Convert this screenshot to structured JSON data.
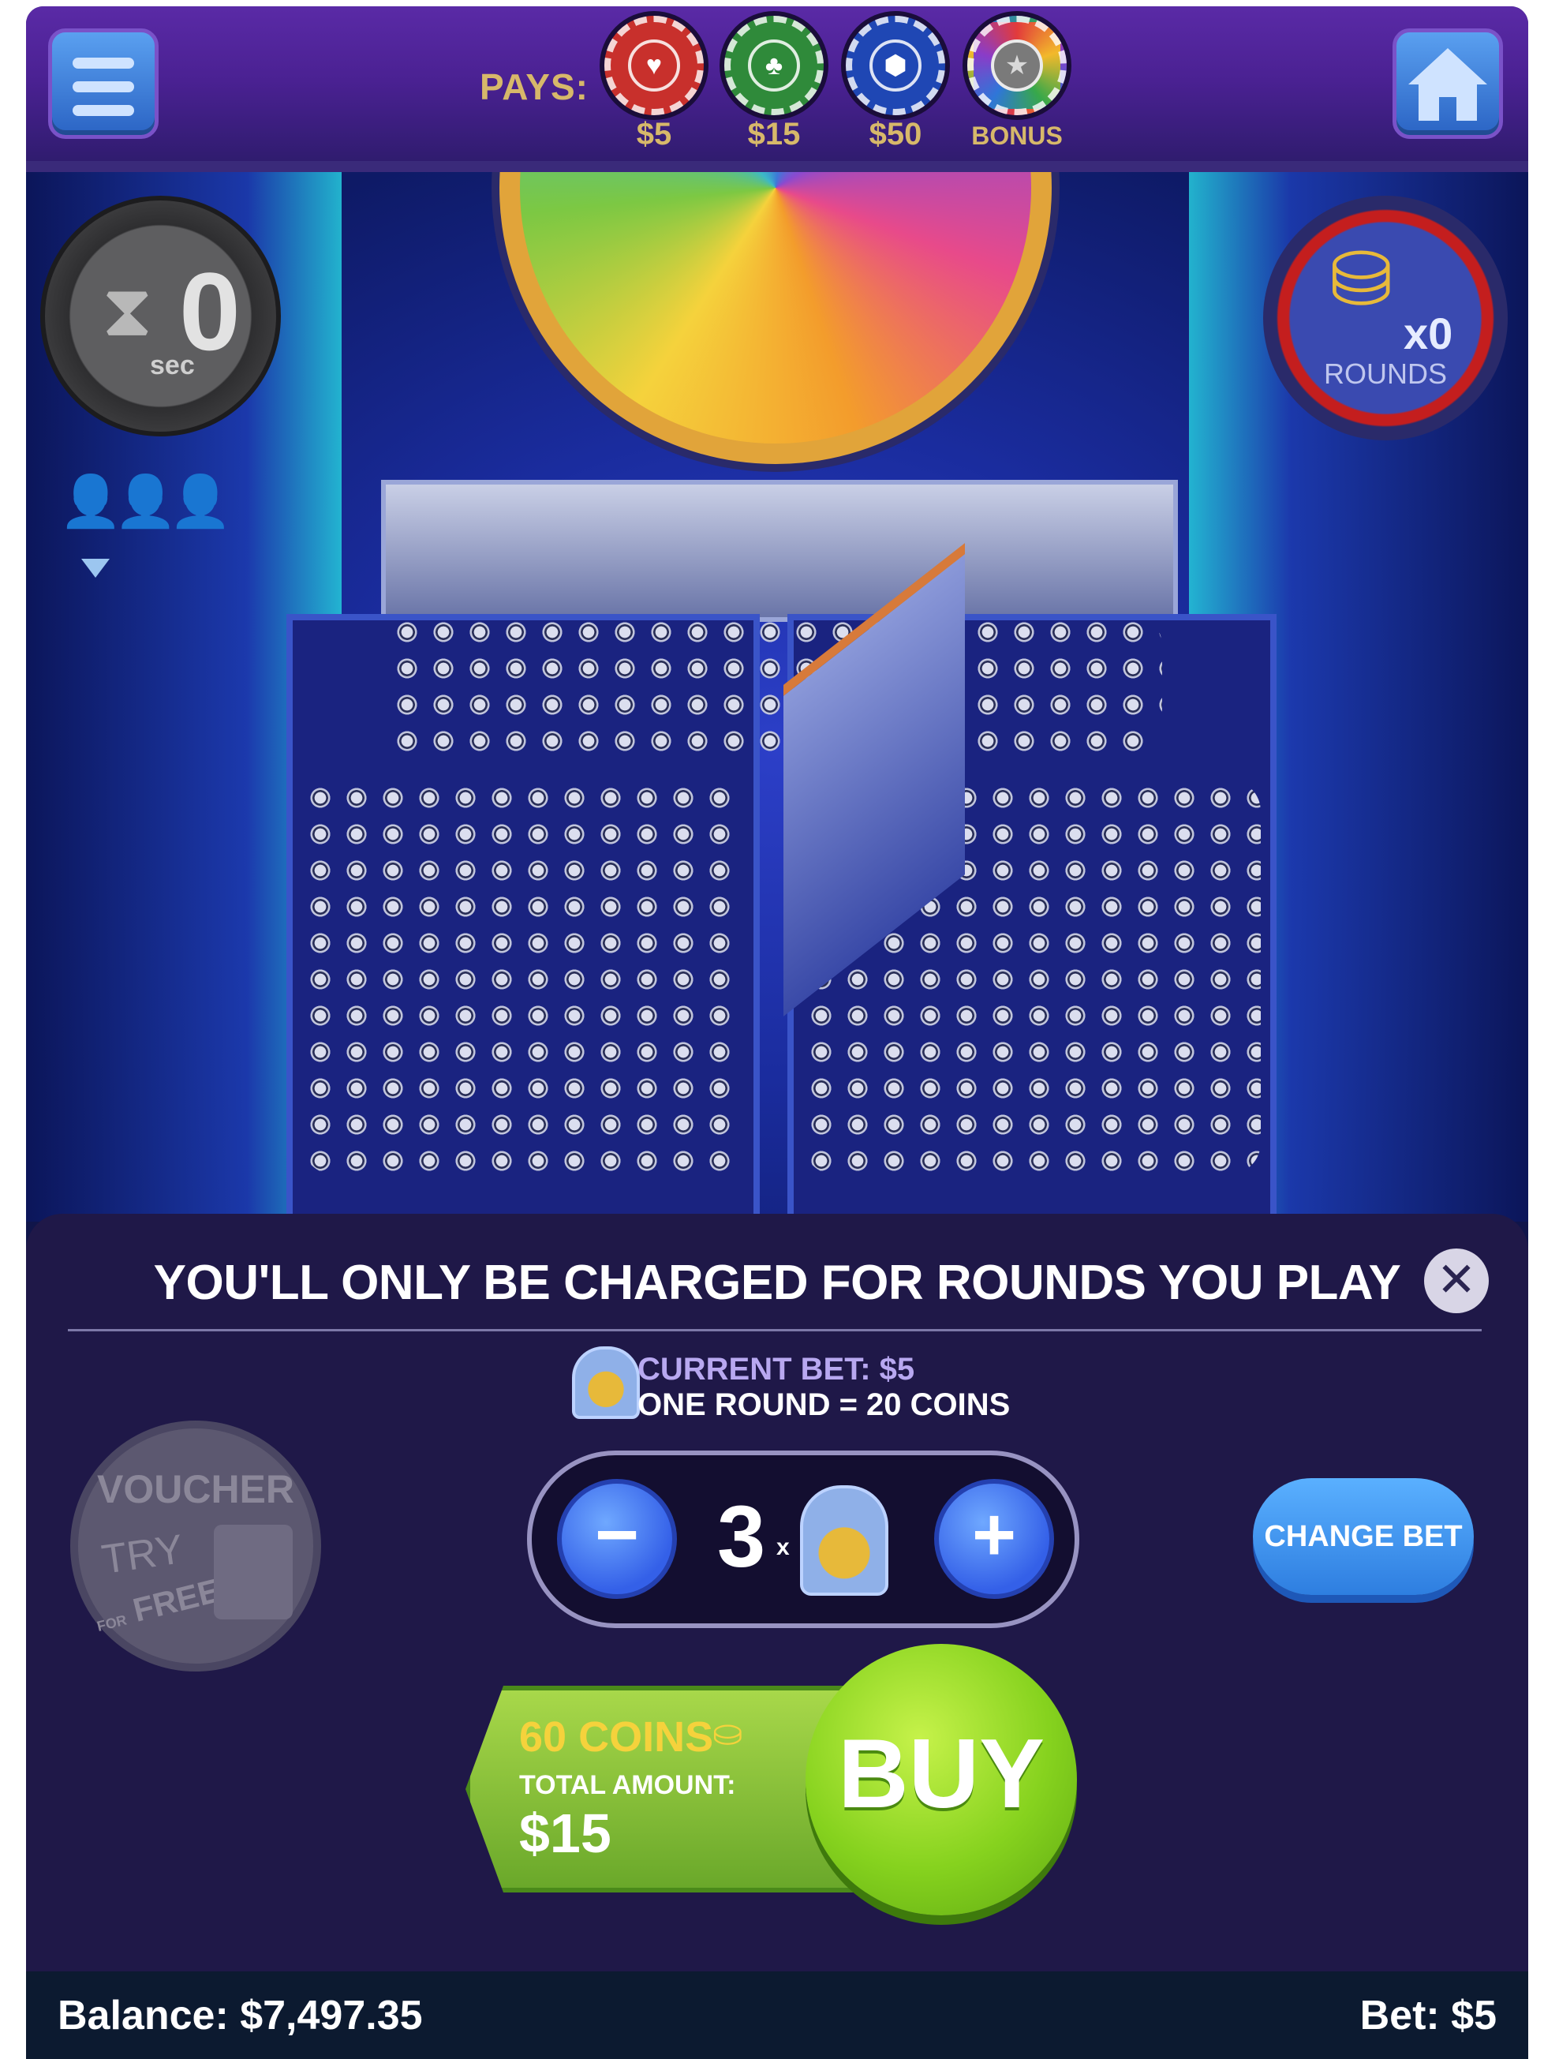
{
  "topbar": {
    "pays_label": "PAYS:",
    "chips": [
      {
        "value": "$5",
        "color": "#c8302c",
        "icon": "heart-icon"
      },
      {
        "value": "$15",
        "color": "#2f8a3a",
        "icon": "club-icon"
      },
      {
        "value": "$50",
        "color": "#1f47b4",
        "icon": "hexagon-icon"
      },
      {
        "value": "BONUS",
        "color": "multicolor",
        "icon": "star-icon"
      }
    ]
  },
  "timer": {
    "value": "0",
    "unit": "sec"
  },
  "rounds_badge": {
    "multiplier": "x0",
    "label": "ROUNDS"
  },
  "sheet": {
    "title": "YOU'LL ONLY BE CHARGED FOR ROUNDS YOU PLAY",
    "close_symbol": "✕",
    "current_bet": "CURRENT BET: $5",
    "one_round": "ONE ROUND = 20 COINS",
    "voucher": {
      "top": "VOUCHER",
      "try": "TRY",
      "for": "FOR",
      "free": "FREE"
    },
    "stepper": {
      "minus": "−",
      "plus": "+",
      "count": "3",
      "times": "x"
    },
    "change_bet_label": "CHANGE BET",
    "buy": {
      "coins": "60 COINS",
      "total_label": "TOTAL AMOUNT:",
      "total": "$15",
      "button_label": "BUY"
    }
  },
  "status": {
    "balance": "Balance: $7,497.35",
    "bet": "Bet: $5"
  },
  "colors": {
    "accent_green": "#86d21e",
    "accent_blue": "#2e7ee0",
    "sheet_bg": "#1f1848",
    "top_bar": "#4a2192"
  }
}
